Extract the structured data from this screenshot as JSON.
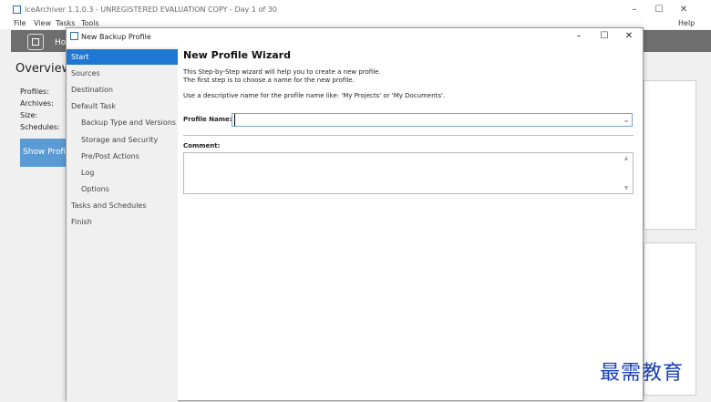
{
  "main_window": {
    "title": "IceArchiver 1.1.0.3 - UNREGISTERED EVALUATION COPY - Day 1 of 30",
    "menu": {
      "file": "File",
      "view": "View",
      "tasks": "Tasks",
      "tools": "Tools",
      "help": "Help"
    },
    "toolbar": {
      "home_label": "Ho"
    },
    "overview": {
      "title": "Overview",
      "profiles_label": "Profiles:",
      "archives_label": "Archives:",
      "size_label": "Size:",
      "schedules_label": "Schedules:",
      "show_profile_button": "Show Profile"
    }
  },
  "dialog": {
    "title": "New Backup Profile",
    "controls": {
      "minimize": "–",
      "maximize": "☐",
      "close": "✕"
    },
    "nav": [
      {
        "label": "Start",
        "active": true,
        "level": 1
      },
      {
        "label": "Sources",
        "active": false,
        "level": 1
      },
      {
        "label": "Destination",
        "active": false,
        "level": 1
      },
      {
        "label": "Default Task",
        "active": false,
        "level": 1
      },
      {
        "label": "Backup Type and Versions",
        "active": false,
        "level": 2
      },
      {
        "label": "Storage and Security",
        "active": false,
        "level": 2
      },
      {
        "label": "Pre/Post Actions",
        "active": false,
        "level": 2
      },
      {
        "label": "Log",
        "active": false,
        "level": 2
      },
      {
        "label": "Options",
        "active": false,
        "level": 2
      },
      {
        "label": "Tasks and Schedules",
        "active": false,
        "level": 1
      },
      {
        "label": "Finish",
        "active": false,
        "level": 1
      }
    ],
    "content": {
      "heading": "New Profile Wizard",
      "intro_line1": "This Step-by-Step wizard will help you to create a new profile.",
      "intro_line2": "The first step is to choose a name  for the new profile.",
      "intro_line3": "Use a descriptive name for the profile name like: 'My Projects' or 'My Documents'.",
      "profile_name_label": "Profile Name:",
      "profile_name_value": "",
      "comment_label": "Comment:",
      "comment_value": ""
    }
  },
  "watermark": "最需教育",
  "colors": {
    "accent": "#1e78d2",
    "toolbar": "#6e6e6e",
    "show_profile": "#5b9bd5",
    "watermark": "#1a3fb3"
  }
}
